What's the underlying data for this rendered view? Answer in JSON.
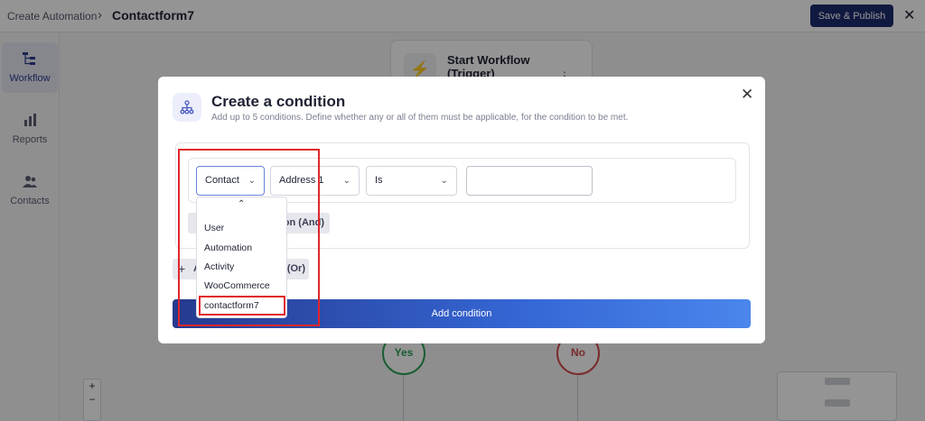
{
  "topbar": {
    "breadcrumb_parent": "Create Automation",
    "breadcrumb_sep": "›",
    "breadcrumb_current": "Contactform7",
    "publish_label": "Save & Publish",
    "close_glyph": "✕"
  },
  "sidebar": {
    "items": [
      {
        "label": "Workflow",
        "icon": "workflow-icon",
        "active": true
      },
      {
        "label": "Reports",
        "icon": "bar-chart-icon",
        "active": false
      },
      {
        "label": "Contacts",
        "icon": "users-icon",
        "active": false
      }
    ]
  },
  "canvas": {
    "start_card_title": "Start Workflow (Trigger)",
    "start_card_icon": "⚡",
    "more_glyph": "⋮",
    "yes_label": "Yes",
    "no_label": "No",
    "zoom_in": "+",
    "zoom_out": "−"
  },
  "modal": {
    "title": "Create a condition",
    "subtitle": "Add up to 5 conditions. Define whether any or all of them must be applicable, for the condition to be met.",
    "close_glyph": "✕",
    "condition": {
      "category": "Contact",
      "field": "Address 1",
      "operator": "Is",
      "value": ""
    },
    "chevron": "⌄",
    "and_button": "ion (And)",
    "or_button_left": "A",
    "or_button_right": "(Or)",
    "plus_glyph": "+",
    "add_condition_label": "Add condition",
    "dropdown": {
      "up_glyph": "⌃",
      "options": [
        "User",
        "Automation",
        "Activity",
        "WooCommerce",
        "contactform7"
      ],
      "selected": "contactform7"
    }
  },
  "colors": {
    "primary": "#1d2d6e",
    "annotation": "#e0262b",
    "yes": "#2ea05a",
    "no": "#d24b4b"
  }
}
